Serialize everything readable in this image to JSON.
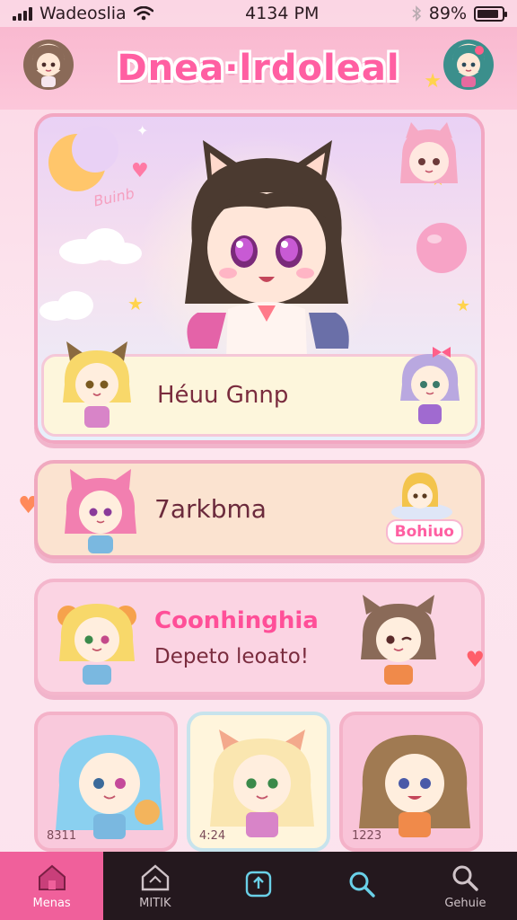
{
  "status": {
    "carrier": "Wadeoslia",
    "time": "4134 PM",
    "battery": "89%",
    "battery_level": 0.89
  },
  "header": {
    "title": "Dnea·lrdoleal"
  },
  "hero": {
    "scribble": "Buinb",
    "caption": "Héuu Gnnp"
  },
  "cards": [
    {
      "label": "7arkbma",
      "badge": "Bohiuo"
    },
    {
      "title": "Coonhinghia",
      "subtitle": "Depeto leoato!"
    }
  ],
  "tiles": [
    {
      "label": "8311"
    },
    {
      "label": "4:24"
    },
    {
      "label": "1223"
    }
  ],
  "nav": [
    {
      "label": "Menas",
      "icon": "home-icon",
      "active": true
    },
    {
      "label": "MITIK",
      "icon": "home-outline-icon",
      "active": false
    },
    {
      "label": "",
      "icon": "upload-icon",
      "active": false
    },
    {
      "label": "",
      "icon": "search-icon",
      "active": false
    },
    {
      "label": "Gehuie",
      "icon": "search-icon",
      "active": false
    }
  ],
  "colors": {
    "accent": "#ff5fa2",
    "nav_active": "#f0609b",
    "nav_bg": "#24181e"
  }
}
